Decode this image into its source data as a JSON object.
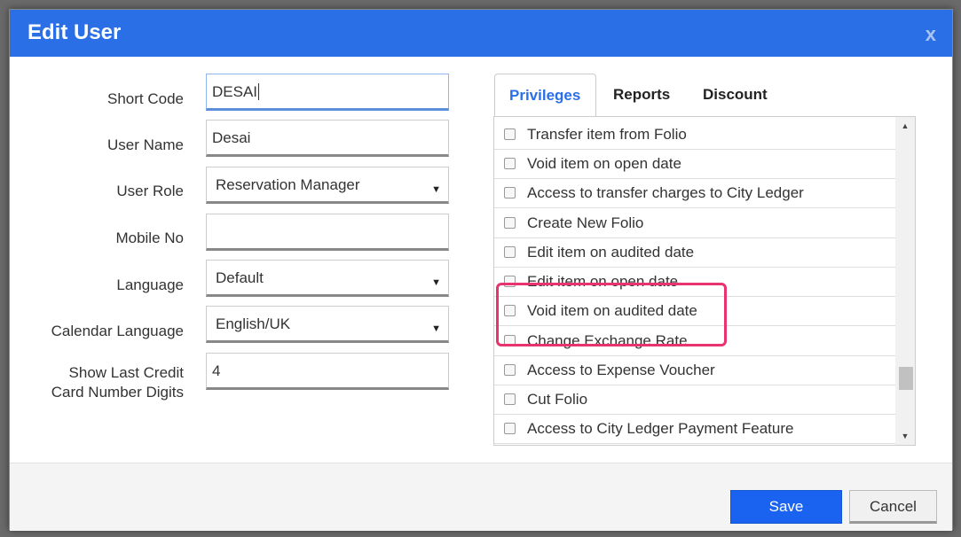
{
  "dialog": {
    "title": "Edit User",
    "close_label": "x"
  },
  "form": {
    "short_code": {
      "label": "Short Code",
      "value": "DESAI"
    },
    "user_name": {
      "label": "User Name",
      "value": "Desai"
    },
    "user_role": {
      "label": "User Role",
      "value": "Reservation Manager"
    },
    "mobile_no": {
      "label": "Mobile No",
      "value": ""
    },
    "language": {
      "label": "Language",
      "value": "Default"
    },
    "calendar_language": {
      "label": "Calendar Language",
      "value": "English/UK"
    },
    "show_last_digits": {
      "label_line1": "Show Last Credit",
      "label_line2": "Card Number Digits",
      "value": "4"
    }
  },
  "tabs": [
    {
      "label": "Privileges",
      "active": true
    },
    {
      "label": "Reports",
      "active": false
    },
    {
      "label": "Discount",
      "active": false
    }
  ],
  "privileges": [
    {
      "label": "Transfer item from Folio",
      "checked": false
    },
    {
      "label": "Void item on open date",
      "checked": false
    },
    {
      "label": "Access to transfer charges to City Ledger",
      "checked": false
    },
    {
      "label": "Create New Folio",
      "checked": false
    },
    {
      "label": "Edit item on audited date",
      "checked": false,
      "highlighted": true
    },
    {
      "label": "Edit item on open date",
      "checked": false,
      "highlighted": true
    },
    {
      "label": "Void item on audited date",
      "checked": false
    },
    {
      "label": "Change Exchange Rate",
      "checked": false
    },
    {
      "label": "Access to Expense Voucher",
      "checked": false
    },
    {
      "label": "Cut Folio",
      "checked": false
    },
    {
      "label": "Access to City Ledger Payment Feature",
      "checked": false
    }
  ],
  "footer": {
    "save_label": "Save",
    "cancel_label": "Cancel"
  },
  "colors": {
    "accent": "#2b6fe6",
    "save_button": "#1a62f0",
    "highlight": "#e8336f"
  }
}
